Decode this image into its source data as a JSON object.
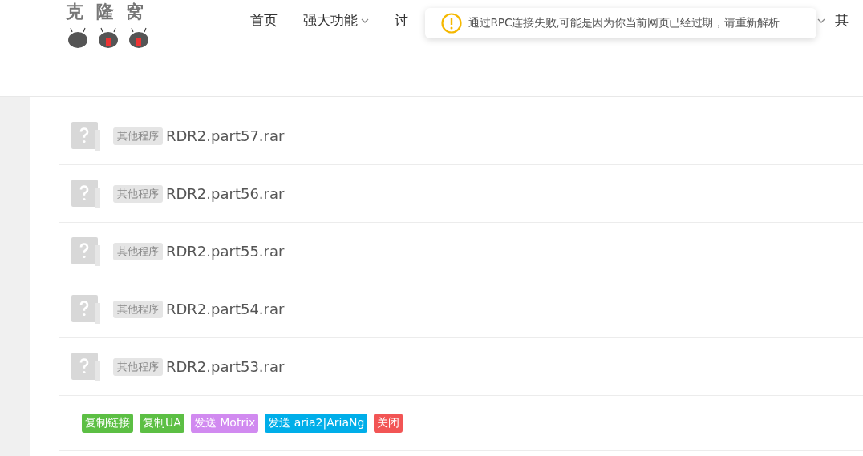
{
  "logo": {
    "title": "克 隆 窝"
  },
  "nav": [
    {
      "label": "首页",
      "dropdown": false
    },
    {
      "label": "强大功能",
      "dropdown": true
    },
    {
      "label": "讨",
      "dropdown": false
    },
    {
      "dropdown": true
    },
    {
      "label": "其",
      "dropdown": false
    }
  ],
  "toast": {
    "message": "通过RPC连接失败,可能是因为你当前网页已经过期，请重新解析"
  },
  "files": [
    {
      "tag": "其他程序",
      "name": "RDR2.part57.rar"
    },
    {
      "tag": "其他程序",
      "name": "RDR2.part56.rar"
    },
    {
      "tag": "其他程序",
      "name": "RDR2.part55.rar"
    },
    {
      "tag": "其他程序",
      "name": "RDR2.part54.rar"
    },
    {
      "tag": "其他程序",
      "name": "RDR2.part53.rar"
    }
  ],
  "actions": [
    {
      "label": "复制链接",
      "color": "#5cbf44"
    },
    {
      "label": "复制UA",
      "color": "#5cbf44"
    },
    {
      "label": "发送 Motrix",
      "color": "#d18af0"
    },
    {
      "label": "发送 aria2|AriaNg",
      "color": "#00aee9"
    },
    {
      "label": "关闭",
      "color": "#f25555"
    }
  ]
}
